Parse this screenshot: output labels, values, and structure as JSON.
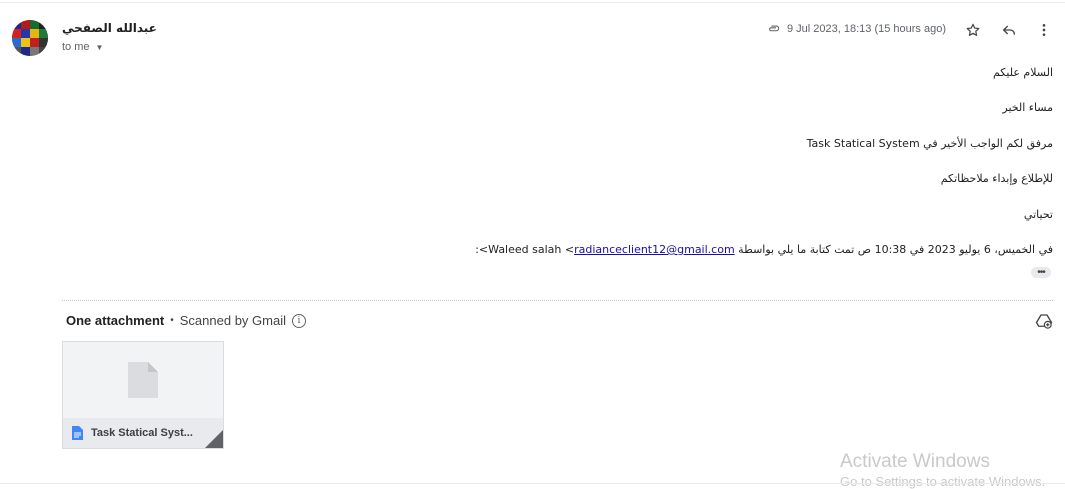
{
  "sender": {
    "name": "عبدالله الصفحي",
    "recipient_label": "to me"
  },
  "meta": {
    "date": "9 Jul 2023, 18:13 (15 hours ago)"
  },
  "body": {
    "lines": [
      "السلام عليكم",
      "مساء الخير",
      "مرفق لكم الواجب الأخير في Task Statical System",
      "للإطلاع وإبداء ملاحظاتكم",
      "تحياتي"
    ],
    "quote_prefix": "في الخميس، 6 يوليو 2023 في 10:38 ص تمت كتابة ما يلي بواسطة Waleed salah <",
    "quote_email": "radianceclient12@gmail.com",
    "quote_suffix": ">:",
    "expand_label": "•••"
  },
  "attachments": {
    "title": "One attachment",
    "scanned": "Scanned by Gmail",
    "info_glyph": "i",
    "items": [
      {
        "name": "Task Statical Syst..."
      }
    ]
  },
  "watermark": {
    "line1": "Activate Windows",
    "line2": "Go to Settings to activate Windows."
  },
  "colors": {
    "link": "#1a0dab",
    "doc_icon": "#4285f4"
  },
  "icons": [
    "paperclip-icon",
    "star-icon",
    "reply-icon",
    "more-vert-icon",
    "add-to-drive-icon",
    "file-icon",
    "docs-icon",
    "info-icon"
  ]
}
